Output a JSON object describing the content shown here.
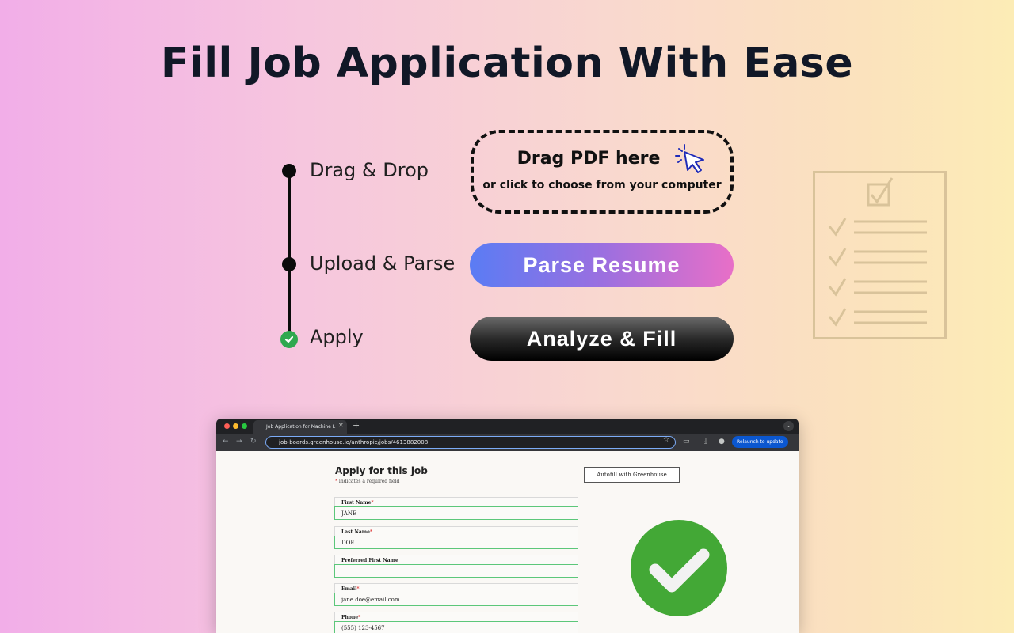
{
  "headline": "Fill Job Application With Ease",
  "steps": [
    {
      "label": "Drag & Drop"
    },
    {
      "label": "Upload & Parse"
    },
    {
      "label": "Apply"
    }
  ],
  "dropzone": {
    "title": "Drag PDF here",
    "subtitle": "or click to choose from your computer"
  },
  "buttons": {
    "parse": "Parse Resume",
    "fill": "Analyze & Fill"
  },
  "colors": {
    "accent_green": "#2fa84f",
    "parse_gradient_start": "#5a7cf4",
    "parse_gradient_end": "#e86fc7"
  },
  "browser": {
    "tab_title": "Job Application for Machine L",
    "url": "job-boards.greenhouse.io/anthropic/jobs/4613882008",
    "relaunch_label": "Relaunch to update",
    "page": {
      "title": "Apply for this job",
      "required_note": "indicates a required field",
      "autofill_label": "Autofill with Greenhouse",
      "fields": [
        {
          "label": "First Name",
          "required": "*",
          "value": "JANE"
        },
        {
          "label": "Last Name",
          "required": "*",
          "value": "DOE"
        },
        {
          "label": "Preferred First Name",
          "required": "",
          "value": ""
        },
        {
          "label": "Email",
          "required": "*",
          "value": "jane.doe@email.com"
        },
        {
          "label": "Phone",
          "required": "*",
          "value": "(555) 123-4567"
        }
      ]
    }
  }
}
